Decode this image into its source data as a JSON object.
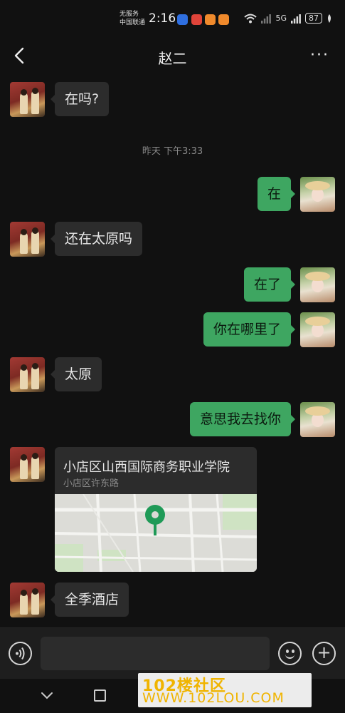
{
  "status_bar": {
    "carrier_line1": "无服务",
    "carrier_line2": "中国联通",
    "time": "2:16",
    "network_5g": "5G",
    "battery": "87"
  },
  "header": {
    "title": "赵二",
    "more_label": "···"
  },
  "messages": {
    "m1": "在吗?",
    "timestamp": "昨天 下午3:33",
    "m2": "在",
    "m3": "还在太原吗",
    "m4": "在了",
    "m5": "你在哪里了",
    "m6": "太原",
    "m7": "意思我去找你",
    "location": {
      "title": "小店区山西国际商务职业学院",
      "address": "小店区许东路"
    },
    "m8": "全季酒店"
  },
  "input": {
    "value": "",
    "voice_label": "◐)",
    "plus_label": "+"
  },
  "navbar": {
    "back_label": "∨"
  },
  "watermark": {
    "line1": "102楼社区",
    "line2": "WWW.102LOU.COM"
  },
  "colors": {
    "outgoing_bubble": "#3ea661",
    "incoming_bubble": "#2c2c2c",
    "background": "#111111"
  }
}
